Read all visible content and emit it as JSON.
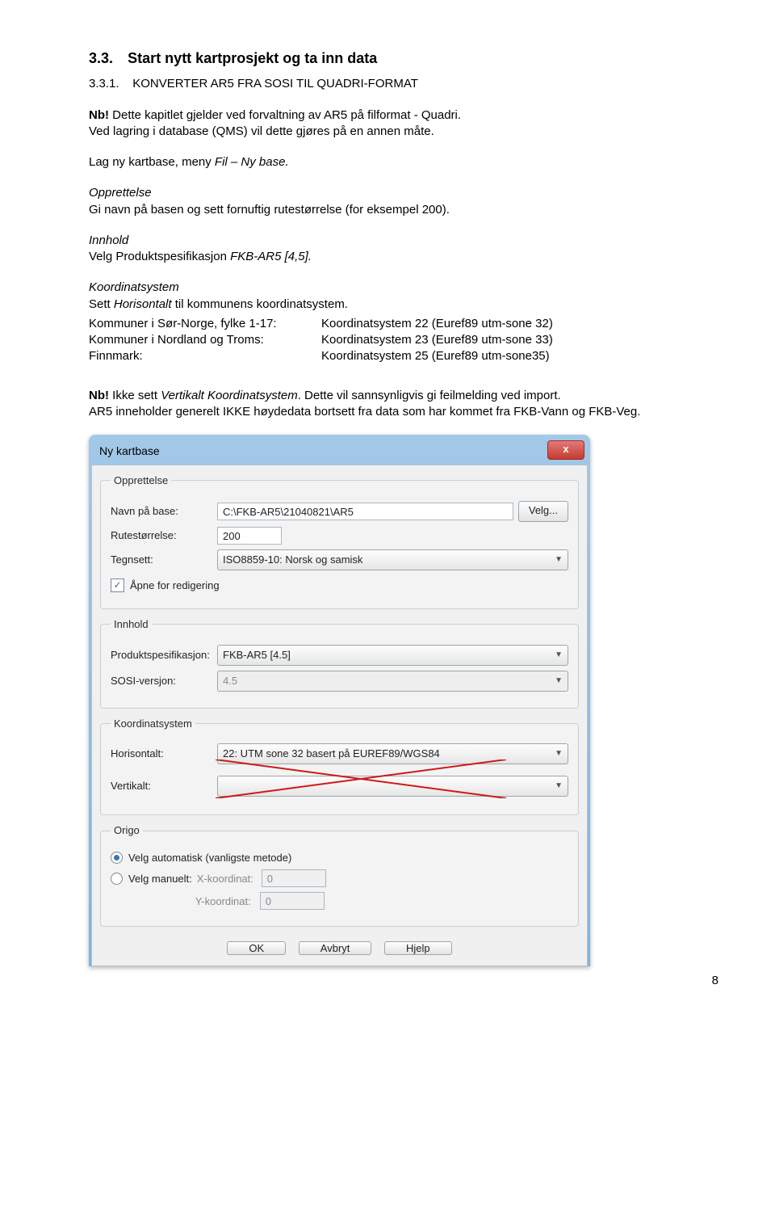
{
  "heading": {
    "num": "3.3.",
    "text": "Start nytt kartprosjekt og ta inn data"
  },
  "sub": {
    "num": "3.3.1.",
    "text": "KONVERTER AR5 FRA SOSI TIL QUADRI-FORMAT"
  },
  "intro": {
    "nb": "Nb!",
    "line1": " Dette kapitlet gjelder ved forvaltning av AR5 på filformat - Quadri.",
    "line2": "Ved lagring i database (QMS) vil dette gjøres på en annen måte."
  },
  "p1": {
    "a": "Lag ny kartbase, meny ",
    "i": "Fil – Ny base."
  },
  "opp": {
    "t": "Opprettelse",
    "b": "Gi navn på basen og sett fornuftig rutestørrelse (for eksempel 200)."
  },
  "inn": {
    "t": "Innhold",
    "b1": "Velg Produktspesifikasjon ",
    "b2": "FKB-AR5 [4,5]."
  },
  "koord": {
    "t": "Koordinatsystem",
    "sa": "Sett ",
    "si": "Horisontalt",
    "sb": " til kommunens koordinatsystem.",
    "rows": [
      {
        "l": "Kommuner i Sør-Norge, fylke 1-17:",
        "r": "Koordinatsystem  22 (Euref89 utm-sone 32)"
      },
      {
        "l": "Kommuner i Nordland og Troms:",
        "r": "Koordinatsystem  23 (Euref89 utm-sone 33)"
      },
      {
        "l": "Finnmark:",
        "r": "Koordinatsystem  25 (Euref89 utm-sone35)"
      }
    ]
  },
  "warn": {
    "nb": "Nb!",
    "a": " Ikke sett ",
    "i": "Vertikalt Koordinatsystem",
    "b": ". Dette vil sannsynligvis gi feilmelding ved import.",
    "c": "AR5 inneholder generelt IKKE høydedata bortsett fra data som har kommet fra FKB-Vann og FKB-Veg."
  },
  "pagenum": "8",
  "dlg": {
    "title": "Ny kartbase",
    "close": "x",
    "grp_opp": "Opprettelse",
    "lbl_navn": "Navn på base:",
    "val_navn": "C:\\FKB-AR5\\21040821\\AR5",
    "btn_velg": "Velg...",
    "lbl_rute": "Rutestørrelse:",
    "val_rute": "200",
    "lbl_tegn": "Tegnsett:",
    "val_tegn": "ISO8859-10: Norsk og samisk",
    "chk_open": "Åpne for redigering",
    "grp_inn": "Innhold",
    "lbl_prod": "Produktspesifikasjon:",
    "val_prod": "FKB-AR5 [4.5]",
    "lbl_sosi": "SOSI-versjon:",
    "val_sosi": "4.5",
    "grp_koord": "Koordinatsystem",
    "lbl_hor": "Horisontalt:",
    "val_hor": "22: UTM sone 32 basert på EUREF89/WGS84",
    "lbl_ver": "Vertikalt:",
    "grp_origo": "Origo",
    "r1": "Velg automatisk (vanligste metode)",
    "r2": "Velg manuelt:",
    "xk": "X-koordinat:",
    "yk": "Y-koordinat:",
    "zero": "0",
    "ok": "OK",
    "avbryt": "Avbryt",
    "hjelp": "Hjelp"
  }
}
